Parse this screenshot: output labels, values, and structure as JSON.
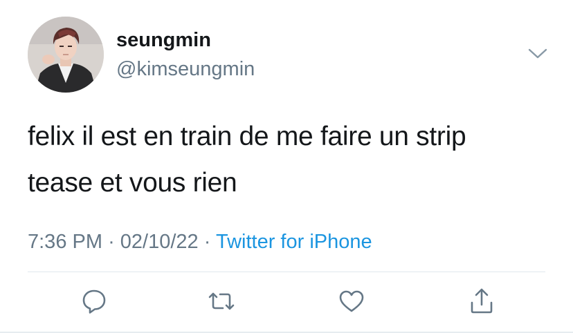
{
  "tweet": {
    "author": {
      "display_name": "seungmin",
      "handle": "@kimseungmin",
      "avatar_icon": "profile-photo"
    },
    "text": "felix il est en train de me faire un strip\ntease et vous rien",
    "time": "7:36 PM",
    "separator": "·",
    "date": "02/10/22",
    "source": "Twitter for iPhone"
  },
  "actions": [
    {
      "name": "reply",
      "icon": "speech-bubble-icon"
    },
    {
      "name": "retweet",
      "icon": "retweet-icon"
    },
    {
      "name": "like",
      "icon": "heart-icon"
    },
    {
      "name": "share",
      "icon": "share-icon"
    }
  ],
  "colors": {
    "text": "#14171a",
    "secondary": "#657786",
    "link": "#1b95e0",
    "divider": "#e1e8ed"
  }
}
